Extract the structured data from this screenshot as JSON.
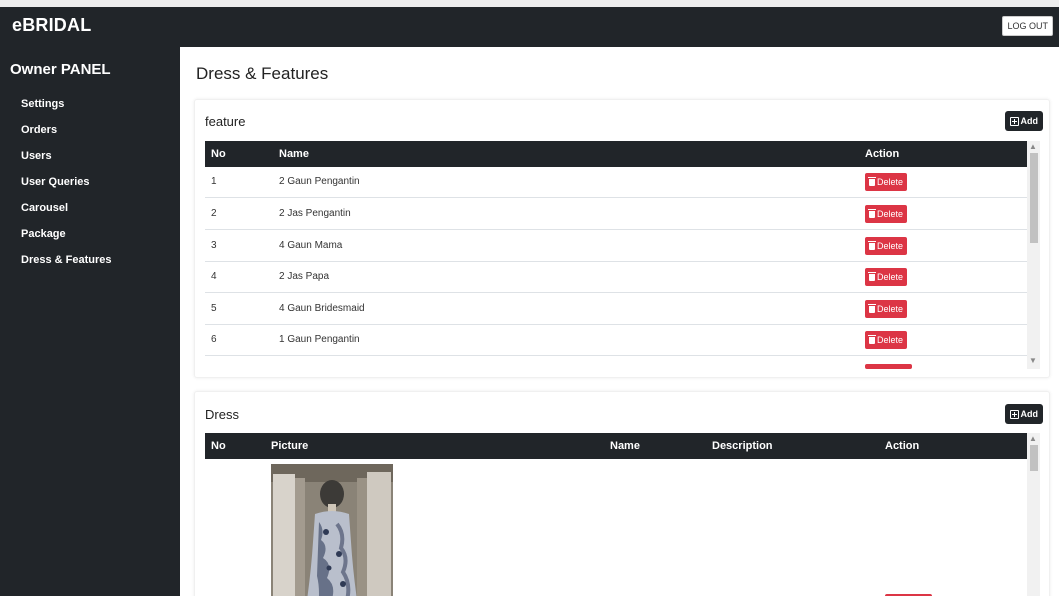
{
  "app": {
    "brand": "eBRIDAL",
    "logout_label": "LOG OUT"
  },
  "sidebar": {
    "title": "Owner PANEL",
    "items": [
      {
        "label": "Settings"
      },
      {
        "label": "Orders"
      },
      {
        "label": "Users"
      },
      {
        "label": "User Queries"
      },
      {
        "label": "Carousel"
      },
      {
        "label": "Package"
      },
      {
        "label": "Dress & Features"
      }
    ]
  },
  "page": {
    "title": "Dress & Features"
  },
  "feature": {
    "heading": "feature",
    "add_label": "Add",
    "columns": {
      "no": "No",
      "name": "Name",
      "action": "Action"
    },
    "delete_label": "Delete",
    "rows": [
      {
        "no": "1",
        "name": "2 Gaun Pengantin"
      },
      {
        "no": "2",
        "name": "2 Jas Pengantin"
      },
      {
        "no": "3",
        "name": "4 Gaun Mama"
      },
      {
        "no": "4",
        "name": "2 Jas Papa"
      },
      {
        "no": "5",
        "name": "4 Gaun Bridesmaid"
      },
      {
        "no": "6",
        "name": "1 Gaun Pengantin"
      }
    ]
  },
  "dress": {
    "heading": "Dress",
    "add_label": "Add",
    "columns": {
      "no": "No",
      "picture": "Picture",
      "name": "Name",
      "description": "Description",
      "action": "Action"
    }
  },
  "colors": {
    "dark": "#212529",
    "danger": "#dc3545",
    "white": "#ffffff"
  }
}
